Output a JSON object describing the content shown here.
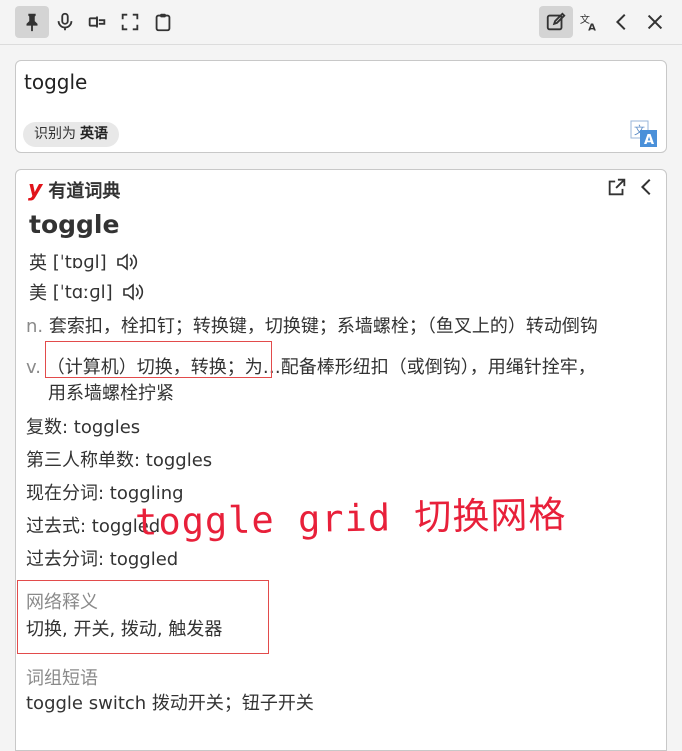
{
  "toolbar": {
    "icons": [
      "pin-icon",
      "microphone-icon",
      "screenshot-ocr-icon",
      "fullscreen-icon",
      "clipboard-icon",
      "edit-icon",
      "translate-icon",
      "back-icon",
      "close-icon"
    ]
  },
  "input": {
    "text": "toggle",
    "detected_prefix": "识别为",
    "detected_lang": "英语"
  },
  "dict": {
    "logo": "y",
    "name": "有道词典",
    "word": "toggle",
    "phonetics": [
      {
        "region": "英",
        "ipa": "[ˈtɒɡl]"
      },
      {
        "region": "美",
        "ipa": "[ˈtɑːɡl]"
      }
    ],
    "definitions": [
      {
        "pos": "n.",
        "text": "套索扣，栓扣钉；转换键，切换键；系墙螺栓；（鱼叉上的）转动倒钩"
      },
      {
        "pos": "v.",
        "text": "（计算机）切换，转换；为…配备棒形纽扣（或倒钩），用绳针拴牢，",
        "cont": "用系墙螺栓拧紧"
      }
    ],
    "forms": [
      "复数: toggles",
      "第三人称单数: toggles",
      "现在分词: toggling",
      "过去式: toggled",
      "过去分词: toggled"
    ],
    "web_label": "网络释义",
    "web_text": "切换, 开关, 拨动, 触发器",
    "phrase_label": "词组短语",
    "phrase_text": "toggle switch 拨动开关；钮子开关"
  },
  "annotation": "toggle grid 切换网格",
  "colors": {
    "accent_red": "#e24b4b",
    "logo_red": "#e1141b"
  }
}
